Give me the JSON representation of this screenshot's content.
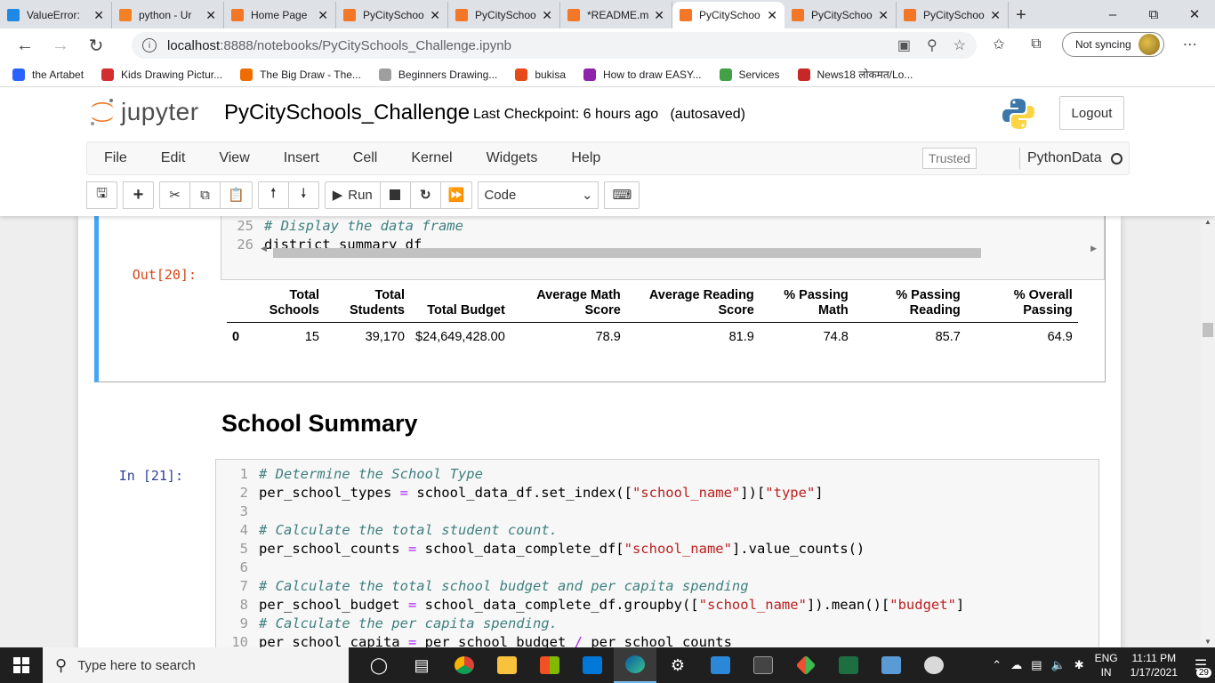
{
  "browser": {
    "tabs": [
      {
        "title": "ValueError:",
        "icon_color": "#1e88e5",
        "active": false
      },
      {
        "title": "python - Ur",
        "icon_color": "#f48024",
        "active": false
      },
      {
        "title": "Home Page",
        "icon_color": "#f37726",
        "active": false
      },
      {
        "title": "PyCitySchoo",
        "icon_color": "#f37726",
        "active": false
      },
      {
        "title": "PyCitySchoo",
        "icon_color": "#f37726",
        "active": false
      },
      {
        "title": "*README.m",
        "icon_color": "#f37726",
        "active": false
      },
      {
        "title": "PyCitySchoo",
        "icon_color": "#f37726",
        "active": true
      },
      {
        "title": "PyCitySchoo",
        "icon_color": "#f37726",
        "active": false
      },
      {
        "title": "PyCitySchoo",
        "icon_color": "#f37726",
        "active": false
      }
    ],
    "new_tab": "+",
    "url_host": "localhost",
    "url_rest": ":8888/notebooks/PyCitySchools_Challenge.ipynb",
    "sync_label": "Not syncing",
    "bookmarks": [
      {
        "label": "the Artabet",
        "color": "#2962ff"
      },
      {
        "label": "Kids Drawing Pictur...",
        "color": "#d32f2f"
      },
      {
        "label": "The Big Draw - The...",
        "color": "#ef6c00"
      },
      {
        "label": "Beginners Drawing...",
        "color": "#9e9e9e"
      },
      {
        "label": "bukisa",
        "color": "#e64a19"
      },
      {
        "label": "How to draw EASY...",
        "color": "#8e24aa"
      },
      {
        "label": "Services",
        "color": "#43a047"
      },
      {
        "label": "News18 लोकमत/Lo...",
        "color": "#c62828"
      }
    ]
  },
  "jupyter": {
    "logo_text": "jupyter",
    "notebook_name": "PyCitySchools_Challenge",
    "checkpoint": "Last Checkpoint: 6 hours ago   (autosaved)",
    "logout_label": "Logout",
    "menus": [
      "File",
      "Edit",
      "View",
      "Insert",
      "Cell",
      "Kernel",
      "Widgets",
      "Help"
    ],
    "trusted_label": "Trusted",
    "kernel_label": "PythonData",
    "run_label": "Run",
    "cell_type": "Code"
  },
  "cell20": {
    "lines": [
      {
        "n": "25",
        "text": "# Display the data frame",
        "kind": "comment"
      },
      {
        "n": "26",
        "text": "district_summary_df",
        "kind": "plain"
      }
    ],
    "out_prompt": "Out[20]:",
    "table": {
      "headers": [
        [
          "Total",
          "Schools"
        ],
        [
          "Total",
          "Students"
        ],
        [
          "Total Budget"
        ],
        [
          "Average Math",
          "Score"
        ],
        [
          "Average Reading",
          "Score"
        ],
        [
          "% Passing",
          "Math"
        ],
        [
          "% Passing",
          "Reading"
        ],
        [
          "% Overall",
          "Passing"
        ]
      ],
      "rows": [
        [
          "0",
          "15",
          "39,170",
          "$24,649,428.00",
          "78.9",
          "81.9",
          "74.8",
          "85.7",
          "64.9"
        ]
      ]
    }
  },
  "heading": "School Summary",
  "cell21": {
    "in_prompt": "In [21]:",
    "lines": [
      {
        "n": "1",
        "html": "<span class=\"cm\"># Determine the School Type</span>"
      },
      {
        "n": "2",
        "html": "per_school_types <span class=\"op\">=</span> school_data_df.set_index([<span class=\"str\">\"school_name\"</span>])[<span class=\"str\">\"type\"</span>]"
      },
      {
        "n": "3",
        "html": ""
      },
      {
        "n": "4",
        "html": "<span class=\"cm\"># Calculate the total student count.</span>"
      },
      {
        "n": "5",
        "html": "per_school_counts <span class=\"op\">=</span> school_data_complete_df[<span class=\"str\">\"school_name\"</span>].value_counts()"
      },
      {
        "n": "6",
        "html": ""
      },
      {
        "n": "7",
        "html": "<span class=\"cm\"># Calculate the total school budget and per capita spending</span>"
      },
      {
        "n": "8",
        "html": "per_school_budget <span class=\"op\">=</span> school_data_complete_df.groupby([<span class=\"str\">\"school_name\"</span>]).mean()[<span class=\"str\">\"budget\"</span>]"
      },
      {
        "n": "9",
        "html": "<span class=\"cm\"># Calculate the per capita spending.</span>"
      },
      {
        "n": "10",
        "html": "per_school_capita <span class=\"op\">=</span> per_school_budget <span class=\"op\">/</span> per_school_counts"
      }
    ]
  },
  "taskbar": {
    "search_placeholder": "Type here to search",
    "lang_top": "ENG",
    "lang_bottom": "IN",
    "time": "11:11 PM",
    "date": "1/17/2021",
    "notif_count": "29"
  }
}
